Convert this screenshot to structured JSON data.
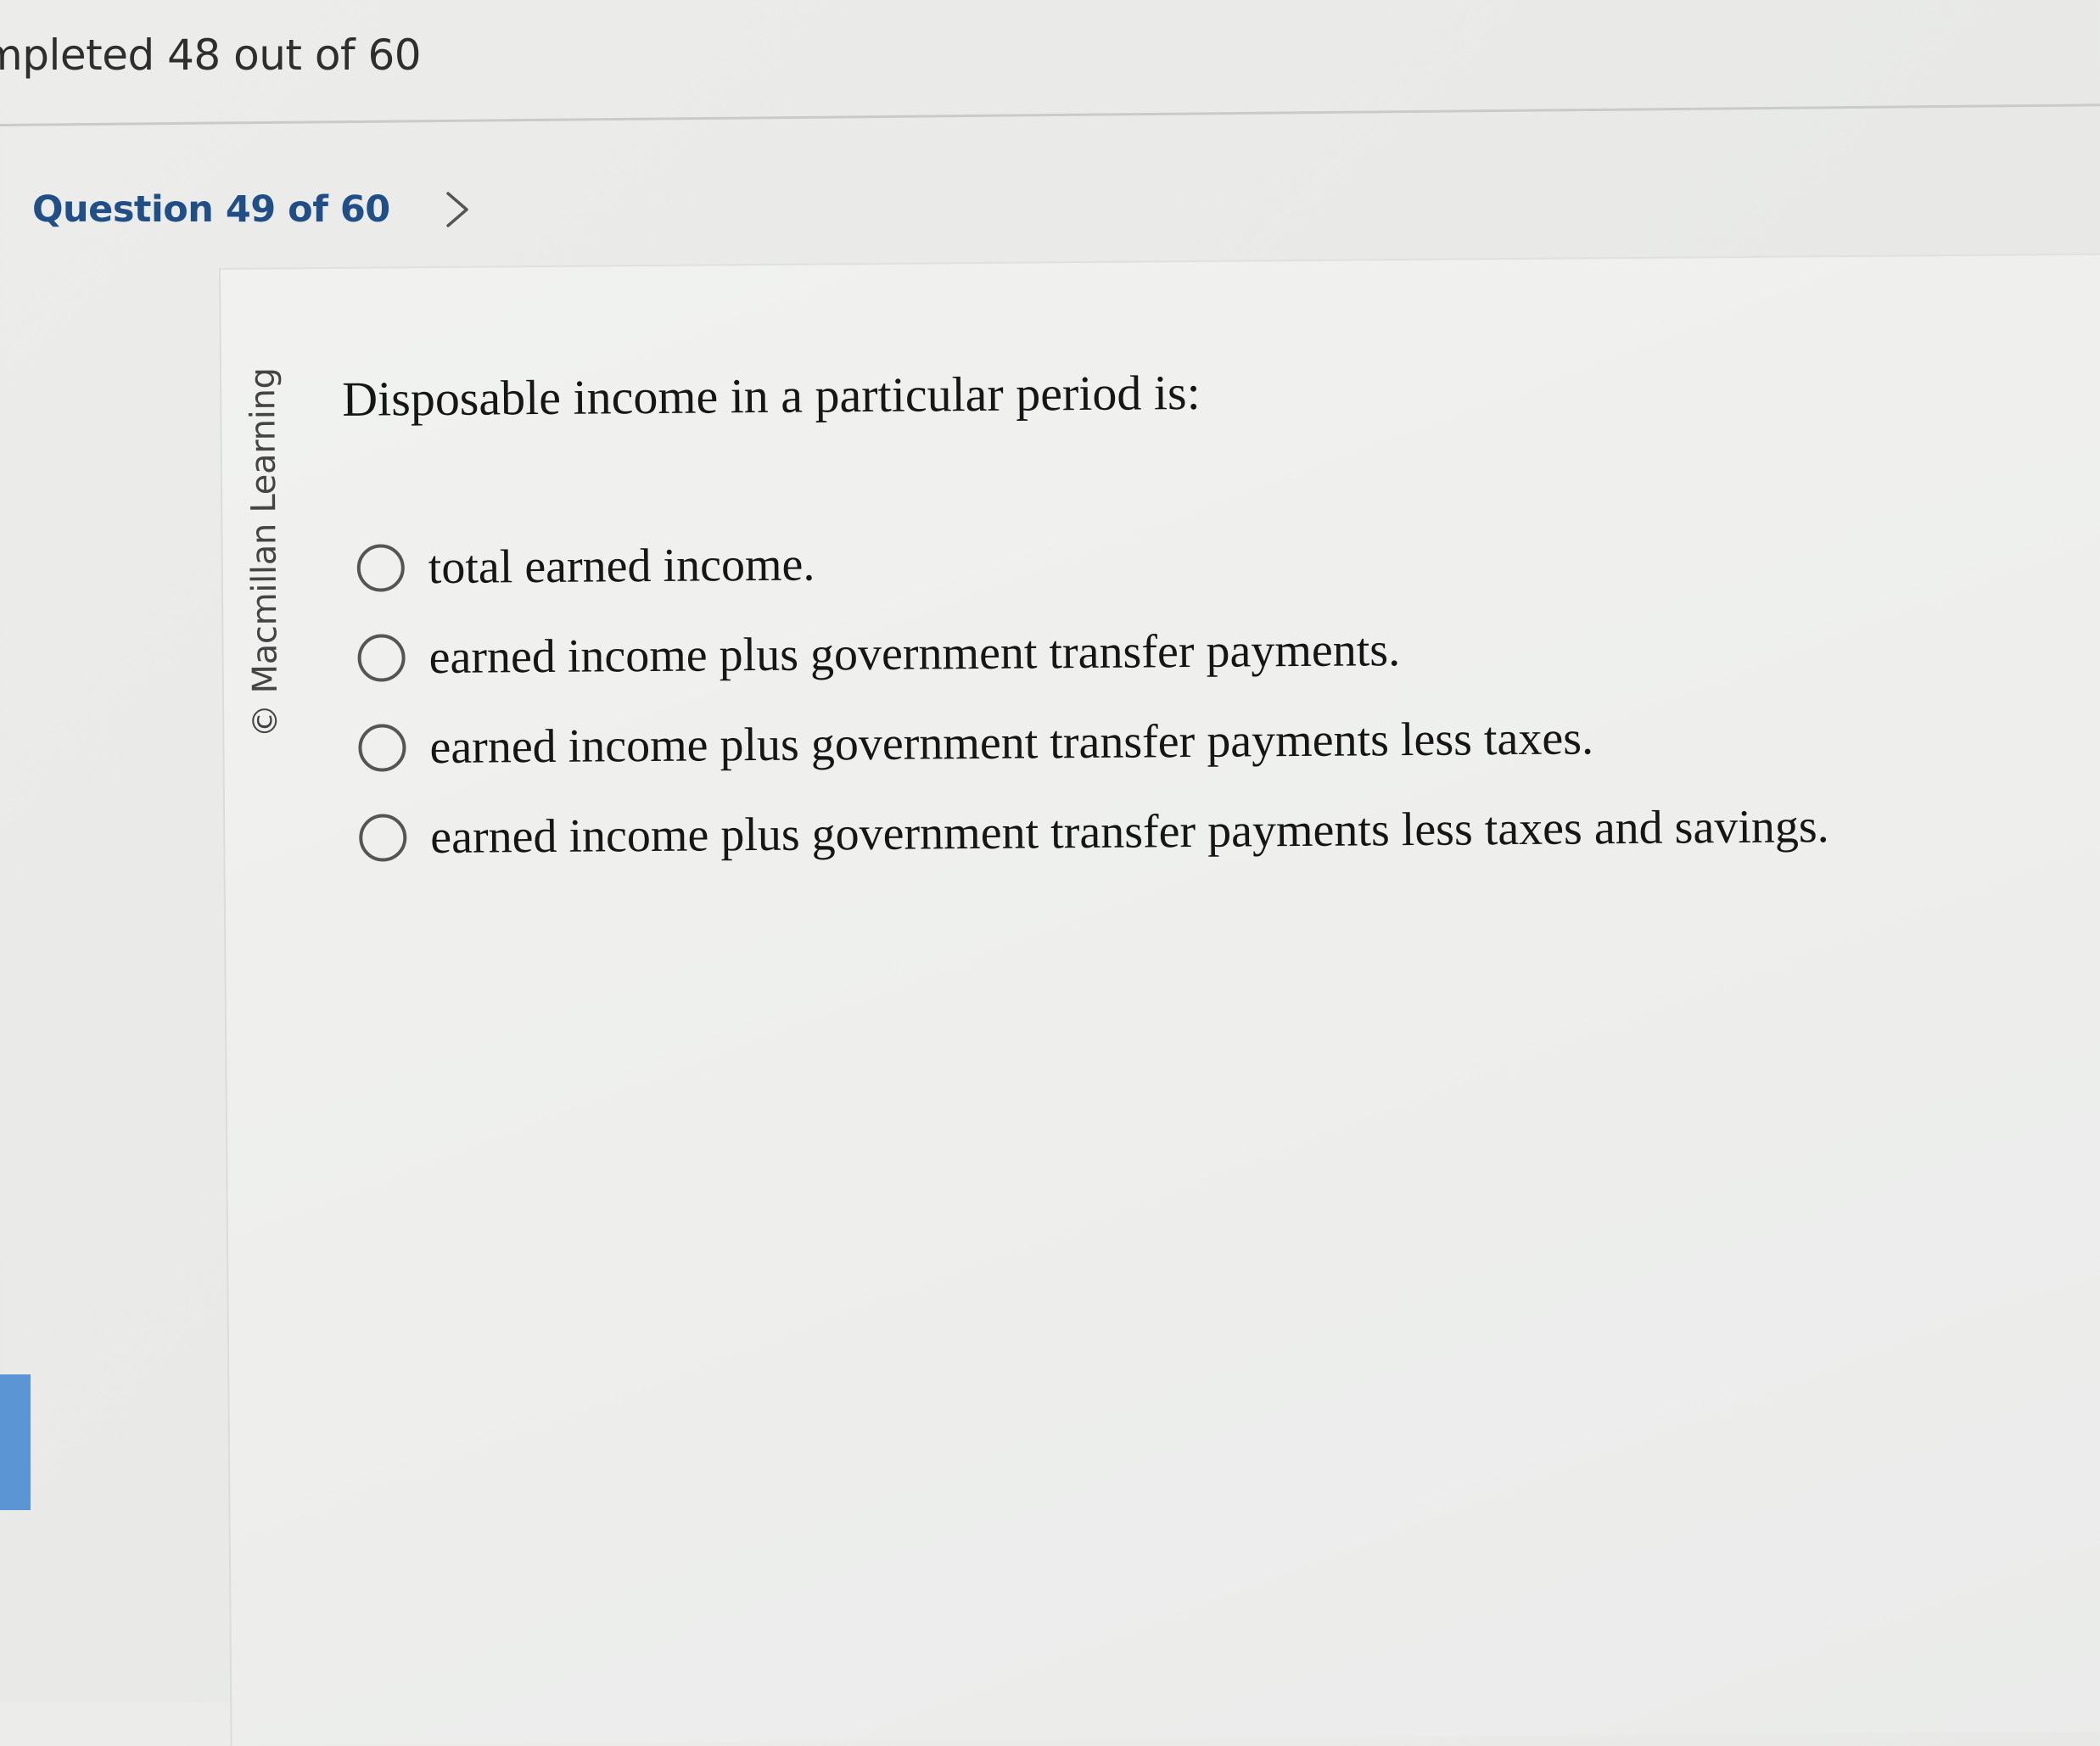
{
  "header": {
    "progress_text": "mpleted 48 out of 60"
  },
  "nav": {
    "question_label": "Question 49 of 60",
    "next_icon": "chevron-right-icon"
  },
  "card": {
    "copyright": "© Macmillan Learning",
    "question": "Disposable income in a particular period is:",
    "options": [
      {
        "label": "total earned income.",
        "selected": false
      },
      {
        "label": "earned income plus government transfer payments.",
        "selected": false
      },
      {
        "label": "earned income plus government transfer payments less taxes.",
        "selected": false
      },
      {
        "label": "earned income plus government transfer payments less taxes and savings.",
        "selected": false
      }
    ]
  },
  "colors": {
    "question_label": "#1f4f86",
    "side_accent": "#5b95d3"
  }
}
